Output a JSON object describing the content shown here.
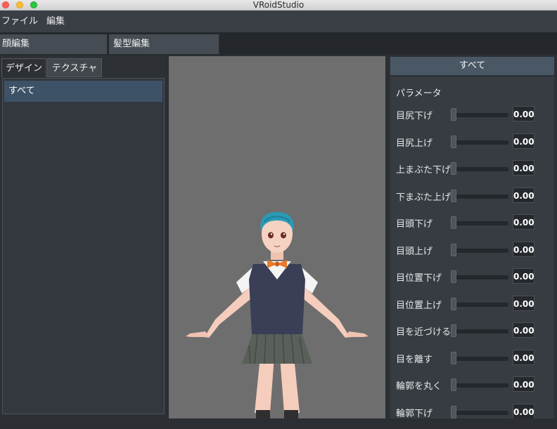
{
  "window": {
    "title": "VRoidStudio"
  },
  "menu": {
    "items": [
      "ファイル",
      "編集"
    ]
  },
  "editor_tabs": [
    "顔編集",
    "髪型編集"
  ],
  "side_tabs": [
    "デザイン",
    "テクスチャ"
  ],
  "side_list": [
    "すべて"
  ],
  "right_panel": {
    "header": "すべて",
    "section_title": "パラメータ",
    "params": [
      {
        "label": "目尻下げ",
        "value": "0.00"
      },
      {
        "label": "目尻上げ",
        "value": "0.00"
      },
      {
        "label": "上まぶた下げ",
        "value": "0.00"
      },
      {
        "label": "下まぶた上げ",
        "value": "0.00"
      },
      {
        "label": "目頭下げ",
        "value": "0.00"
      },
      {
        "label": "目頭上げ",
        "value": "0.00"
      },
      {
        "label": "目位置下げ",
        "value": "0.00"
      },
      {
        "label": "目位置上げ",
        "value": "0.00"
      },
      {
        "label": "目を近づける",
        "value": "0.00"
      },
      {
        "label": "目を離す",
        "value": "0.00"
      },
      {
        "label": "輪郭を丸く",
        "value": "0.00"
      },
      {
        "label": "輪郭下げ",
        "value": "0.00"
      }
    ]
  }
}
